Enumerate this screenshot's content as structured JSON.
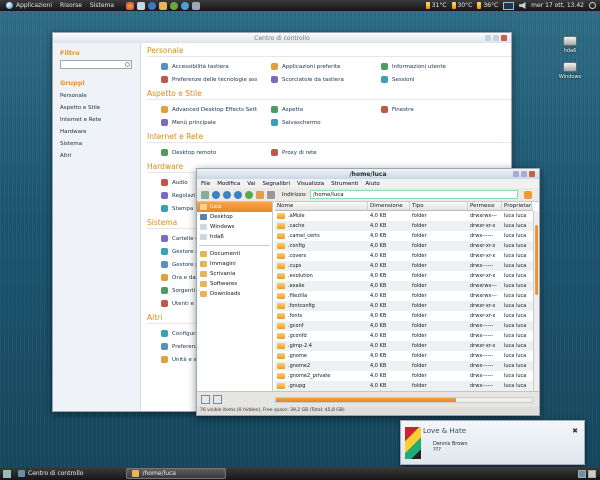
{
  "top_panel": {
    "menus": [
      "Applicazioni",
      "Risorse",
      "Sistema"
    ],
    "temps": [
      "31°C",
      "30°C",
      "36°C"
    ],
    "clock": "mer 17 ott, 13.42"
  },
  "desktop_icons": [
    "hda6",
    "Windows"
  ],
  "control_center": {
    "title": "Centro di controllo",
    "filter_heading": "Filtro",
    "groups_heading": "Gruppi",
    "groups": [
      "Personale",
      "Aspetto e Stile",
      "Internet e Rete",
      "Hardware",
      "Sistema",
      "Altri"
    ],
    "sections": [
      {
        "title": "Personale",
        "items": [
          "Accessibilità tastiera",
          "Applicazioni preferite",
          "Informazioni utente",
          "Preferenze delle tecnologie assistive",
          "Scorciatoie da tastiera",
          "Sessioni"
        ]
      },
      {
        "title": "Aspetto e Stile",
        "items": [
          "Advanced Desktop Effects Settings",
          "Aspetto",
          "Finestre",
          "Menù principale",
          "Salvaschermo"
        ]
      },
      {
        "title": "Internet e Rete",
        "items": [
          "Desktop remoto",
          "Proxy di rete"
        ]
      },
      {
        "title": "Hardware",
        "items": [
          "Audio",
          "Regolazi",
          "Stampa"
        ]
      },
      {
        "title": "Sistema",
        "items": [
          "Cartelle co",
          "Gestore agg",
          "Gestore pa",
          "Ora e data",
          "Sorgenti so",
          "Utenti e gru"
        ]
      },
      {
        "title": "Altri",
        "items": [
          "Configuraz",
          "Preferenze",
          "Unità e sup"
        ]
      }
    ]
  },
  "file_manager": {
    "title": "/home/luca",
    "menu": [
      "File",
      "Modifica",
      "Vai",
      "Segnalibri",
      "Visualizza",
      "Strumenti",
      "Aiuto"
    ],
    "address_label": "Indirizzo:",
    "address_value": "/home/luca",
    "places": [
      "luca",
      "Desktop",
      "Windows",
      "hda6",
      "Documenti",
      "Immagini",
      "Scrivania",
      "Softwares",
      "Downloads"
    ],
    "columns": [
      "Nome",
      "Dimensione",
      "Tipo",
      "Permessi",
      "Proprietario"
    ],
    "rows": [
      [
        ".aMule",
        "4,0 KB",
        "folder",
        "drwxrwx---",
        "luca luca"
      ],
      [
        ".cache",
        "4,0 KB",
        "folder",
        "drwxr-xr-x",
        "luca luca"
      ],
      [
        ".camel_certs",
        "4,0 KB",
        "folder",
        "drwx------",
        "luca luca"
      ],
      [
        ".config",
        "4,0 KB",
        "folder",
        "drwxr-xr-x",
        "luca luca"
      ],
      [
        ".covers",
        "4,0 KB",
        "folder",
        "drwxr-xr-x",
        "luca luca"
      ],
      [
        ".cups",
        "4,0 KB",
        "folder",
        "drwx------",
        "luca luca"
      ],
      [
        ".evolution",
        "4,0 KB",
        "folder",
        "drwxr-xr-x",
        "luca luca"
      ],
      [
        ".exaile",
        "4,0 KB",
        "folder",
        "drwxrwx---",
        "luca luca"
      ],
      [
        ".filezilla",
        "4,0 KB",
        "folder",
        "drwxrwx---",
        "luca luca"
      ],
      [
        ".fontconfig",
        "4,0 KB",
        "folder",
        "drwxr-xr-x",
        "luca luca"
      ],
      [
        ".fonts",
        "4,0 KB",
        "folder",
        "drwxr-xr-x",
        "luca luca"
      ],
      [
        ".gconf",
        "4,0 KB",
        "folder",
        "drwx------",
        "luca luca"
      ],
      [
        ".gconfd",
        "4,0 KB",
        "folder",
        "drwx------",
        "luca luca"
      ],
      [
        ".gimp-2.4",
        "4,0 KB",
        "folder",
        "drwxr-xr-x",
        "luca luca"
      ],
      [
        ".gnome",
        "4,0 KB",
        "folder",
        "drwx------",
        "luca luca"
      ],
      [
        ".gnome2",
        "4,0 KB",
        "folder",
        "drwx------",
        "luca luca"
      ],
      [
        ".gnome2_private",
        "4,0 KB",
        "folder",
        "drwx------",
        "luca luca"
      ],
      [
        ".gnupg",
        "4,0 KB",
        "folder",
        "drwx------",
        "luca luca"
      ],
      [
        ".gnupr",
        "4,0 KB",
        "folder",
        "drwx------",
        "luca luca"
      ]
    ],
    "status": "76 visible items (0 hidden), Free space: 39,2 GB (Total: 45,8 GB)"
  },
  "notification": {
    "title": "Love & Hate",
    "artist": "Dennis Brown",
    "album": "???"
  },
  "taskbar": [
    "Centro di controllo",
    "/home/luca"
  ]
}
